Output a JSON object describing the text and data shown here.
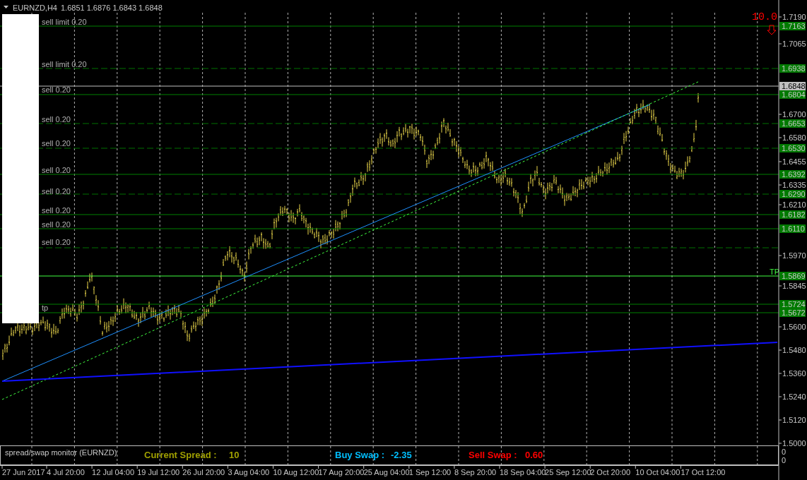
{
  "chart_header": {
    "symbol": "EURNZD,H4",
    "quotes": "1.6851 1.6876 1.6843 1.6848"
  },
  "spread_display": "10.0",
  "price_axis": [
    "1.7190",
    "1.7065",
    "1.6700",
    "1.6580",
    "1.6455",
    "1.6335",
    "1.6210",
    "1.5970",
    "1.5845",
    "1.5600",
    "1.5480",
    "1.5360",
    "1.5240",
    "1.5120",
    "1.5000"
  ],
  "current_price": "1.6848",
  "order_lines": [
    {
      "kind": "solid",
      "price": "1.7163",
      "text": "sell limit 0.20"
    },
    {
      "kind": "dashed",
      "price": "1.6938",
      "text": "sell limit 0.20"
    },
    {
      "kind": "solid",
      "price": "1.6804",
      "text": "sell 0.20"
    },
    {
      "kind": "dashed",
      "price": "1.6653",
      "text": "sell 0.20"
    },
    {
      "kind": "dashed",
      "price": "1.6530",
      "text": "sell 0.20"
    },
    {
      "kind": "solid",
      "price": "1.6392",
      "text": "sell 0.20"
    },
    {
      "kind": "dashed",
      "price": "1.6290",
      "text": "sell 0.20"
    },
    {
      "kind": "solid",
      "price": "1.6182",
      "text": "sell 0.20"
    },
    {
      "kind": "solid",
      "price": "1.6110",
      "text": "sell 0.20"
    },
    {
      "kind": "dashed",
      "text": "sell 0.20"
    },
    {
      "kind": "tp",
      "price": "1.5869",
      "tag": "TP"
    },
    {
      "kind": "solid",
      "price": "1.5724"
    },
    {
      "kind": "solid",
      "price": "1.5672",
      "text": "tp"
    }
  ],
  "time_axis": [
    "27 Jun 2017",
    "4 Jul 20:00",
    "12 Jul 04:00",
    "19 Jul 12:00",
    "26 Jul 20:00",
    "3 Aug 04:00",
    "10 Aug 12:00",
    "17 Aug 20:00",
    "25 Aug 04:00",
    "1 Sep 12:00",
    "8 Sep 20:00",
    "18 Sep 04:00",
    "25 Sep 12:00",
    "2 Oct 20:00",
    "10 Oct 04:00",
    "17 Oct 12:00"
  ],
  "indicator": {
    "title": "spread/swap monitor (EURNZD)",
    "spread_label": "Current Spread :",
    "spread_value": "10",
    "buy_swap_label": "Buy Swap :",
    "buy_swap_value": "-2.35",
    "sell_swap_label": "Sell Swap :",
    "sell_swap_value": "0.60",
    "axis": [
      "0",
      "0"
    ]
  }
}
